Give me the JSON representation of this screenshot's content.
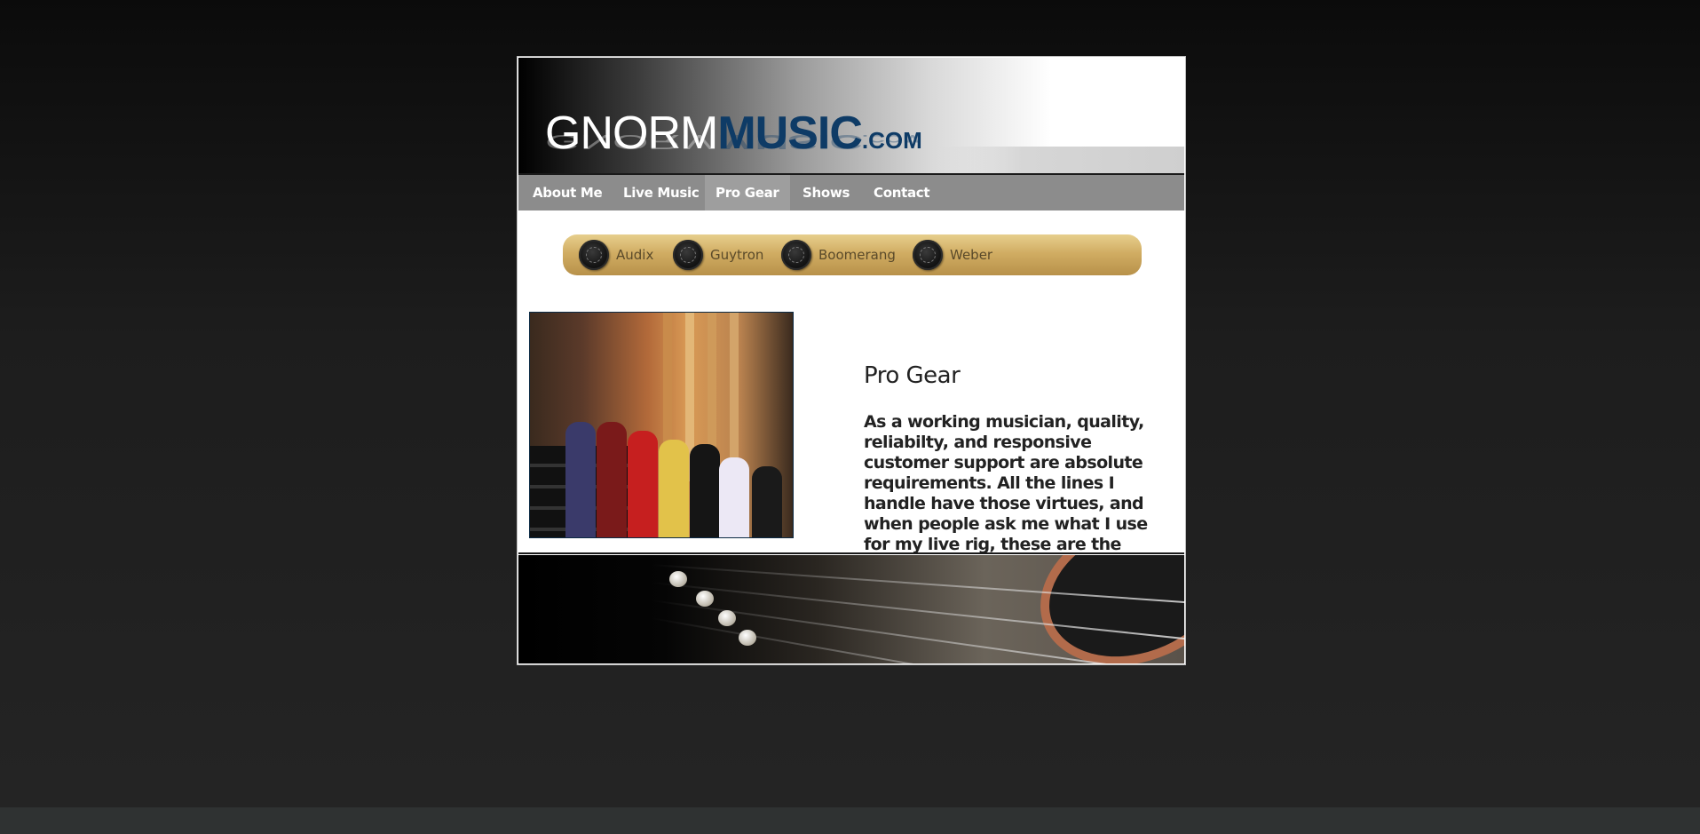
{
  "site": {
    "logo": {
      "part1": "GNORM",
      "part2": "MUSIC",
      "part3": ".COM"
    }
  },
  "nav": {
    "items": [
      {
        "label": "About Me"
      },
      {
        "label": "Live Music"
      },
      {
        "label": "Pro Gear",
        "active": true
      },
      {
        "label": "Shows"
      },
      {
        "label": "Contact"
      }
    ]
  },
  "brands": [
    {
      "label": "Audix",
      "icon": "knob-icon"
    },
    {
      "label": "Guytron",
      "icon": "knob-icon"
    },
    {
      "label": "Boomerang",
      "icon": "knob-icon"
    },
    {
      "label": "Weber",
      "icon": "knob-icon"
    }
  ],
  "content": {
    "title": "Pro Gear",
    "text": "As a working musician, quality, reliabilty, and responsive customer support are absolute requirements. All the lines I handle have those virtues, and when people ask me what I use for my live rig, these are the brands I recommend."
  },
  "colors": {
    "nav_bg": "#8c8c8c",
    "brand_bar": "#d1ad63",
    "logo_blue": "#0e3b66",
    "page_bg": "#1d1d1d"
  }
}
